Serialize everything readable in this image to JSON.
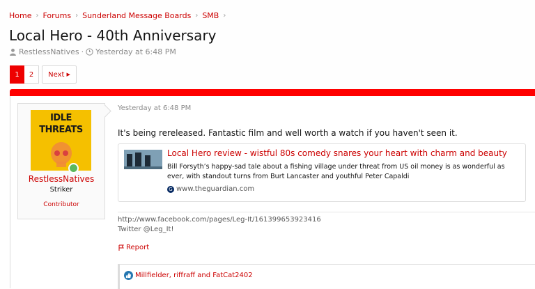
{
  "breadcrumbs": [
    "Home",
    "Forums",
    "Sunderland Message Boards",
    "SMB"
  ],
  "thread": {
    "title": "Local Hero - 40th Anniversary",
    "author": "RestlessNatives",
    "date": "Yesterday at 6:48 PM"
  },
  "pagination": {
    "pages": [
      "1",
      "2"
    ],
    "current": "1",
    "next_label": "Next"
  },
  "post": {
    "date": "Yesterday at 6:48 PM",
    "user": {
      "name": "RestlessNatives",
      "title": "Striker",
      "banner": "Contributor",
      "avatar_text": [
        "IDLE",
        "THREATS"
      ]
    },
    "body": "It's being rereleased. Fantastic film and well worth a watch if you haven't seen it.",
    "embed": {
      "title": "Local Hero review - wistful 80s comedy snares your heart with charm and beauty",
      "description": "Bill Forsyth’s happy-sad tale about a fishing village under threat from US oil money is as wonderful as ever, with standout turns from Burt Lancaster and youthful Peter Capaldi",
      "source": "www.theguardian.com"
    },
    "signature": [
      "http://www.facebook.com/pages/Leg-It/161399653923416",
      "Twitter @Leg_It!"
    ],
    "report_label": "Report",
    "likes": "Millfielder, riffraff and FatCat2402"
  },
  "colors": {
    "accent": "#cc0000",
    "bar": "#ff0000",
    "avatar_bg": "#f5c000"
  }
}
